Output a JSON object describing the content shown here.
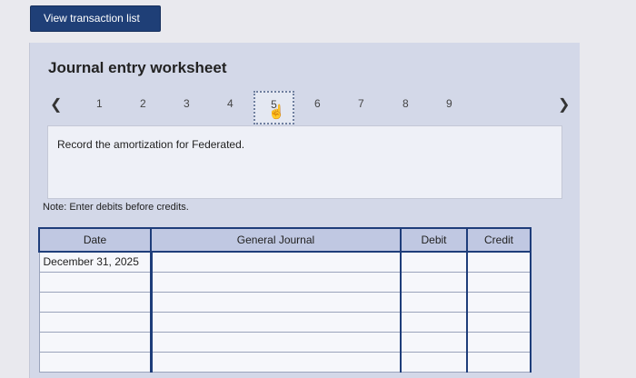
{
  "top_button": {
    "label": "View transaction list"
  },
  "worksheet": {
    "title": "Journal entry worksheet",
    "nav": {
      "prev_icon": "chevron-left-icon",
      "next_icon": "chevron-right-icon",
      "pages": [
        "1",
        "2",
        "3",
        "4",
        "5",
        "6",
        "7",
        "8",
        "9"
      ],
      "active_page": "5"
    },
    "instruction": "Record the amortization for Federated.",
    "note": "Note: Enter debits before credits."
  },
  "journal_table": {
    "columns": [
      "Date",
      "General Journal",
      "Debit",
      "Credit"
    ],
    "rows": [
      [
        "December 31, 2025",
        "",
        "",
        ""
      ],
      [
        "",
        "",
        "",
        ""
      ],
      [
        "",
        "",
        "",
        ""
      ],
      [
        "",
        "",
        "",
        ""
      ],
      [
        "",
        "",
        "",
        ""
      ],
      [
        "",
        "",
        "",
        ""
      ]
    ]
  }
}
